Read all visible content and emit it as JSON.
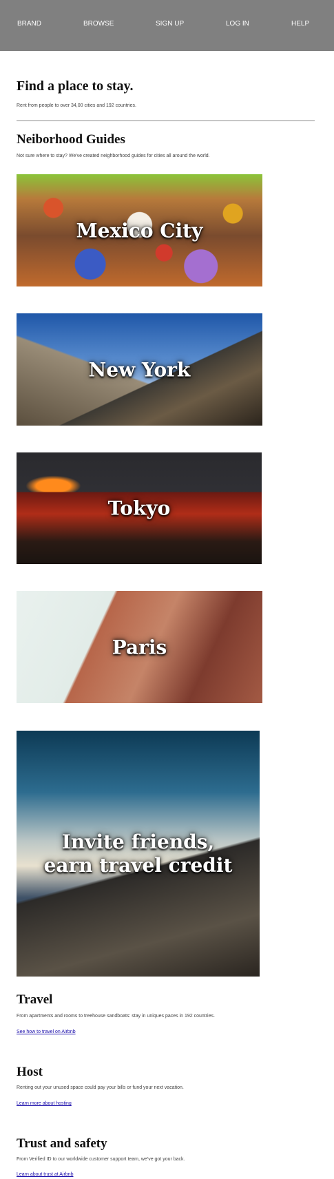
{
  "nav": {
    "items": [
      "BRAND",
      "BROWSE",
      "SIGN UP",
      "LOG IN",
      "HELP"
    ]
  },
  "hero": {
    "title": "Find a place to stay.",
    "subtitle": "Rent from people to over 34,00 cities and 192 countries."
  },
  "guides": {
    "title": "Neiborhood Guides",
    "subtitle": "Not sure where to stay? We've created neighborhood guides for cities all around the world.",
    "cities": [
      "Mexico City",
      "New York",
      "Tokyo",
      "Paris"
    ]
  },
  "invite": {
    "line1": "Invite friends,",
    "line2": "earn travel credit"
  },
  "sections": [
    {
      "title": "Travel",
      "text": "From apartments and rooms to treehouse sandboats: stay in uniques paces in 192 countries.",
      "link": "See how to travel on Airbnb"
    },
    {
      "title": "Host",
      "text": "Renting out your unused space could pay your bills or fund your next vacation.",
      "link": "Learn more about hosting"
    },
    {
      "title": "Trust and safety",
      "text": "From Verified ID to our worldwide customer support team, we've got your back.",
      "link": "Learn about trust at Airbnb"
    }
  ],
  "colors": {
    "nav_bg": "#808080",
    "link": "#1a0dab"
  }
}
